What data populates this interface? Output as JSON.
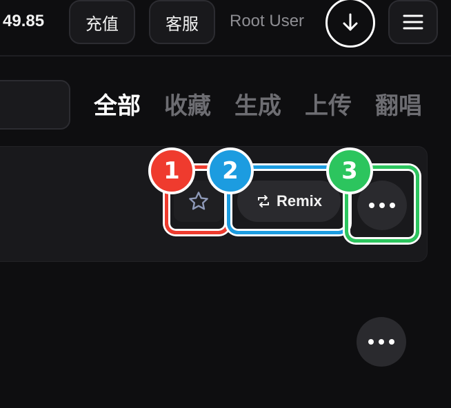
{
  "header": {
    "balance": "49.85",
    "recharge_label": "充值",
    "service_label": "客服",
    "user_name": "Root User",
    "download_icon": "download-icon",
    "menu_icon": "menu-icon"
  },
  "tabs": [
    {
      "label": "全部",
      "active": true
    },
    {
      "label": "收藏",
      "active": false
    },
    {
      "label": "生成",
      "active": false
    },
    {
      "label": "上传",
      "active": false
    },
    {
      "label": "翻唱",
      "active": false
    }
  ],
  "card": {
    "favorite_icon": "star-icon",
    "remix_label": "Remix",
    "remix_icon": "repeat-icon",
    "more_icon": "more-horizontal-icon"
  },
  "annotations": [
    {
      "number": "1",
      "color": "#ef3b2e"
    },
    {
      "number": "2",
      "color": "#1c9ce0"
    },
    {
      "number": "3",
      "color": "#2cc55e"
    }
  ],
  "colors": {
    "background": "#0e0e10",
    "surface": "#19191c",
    "active_tab": "#ffffff",
    "inactive_tab": "#6d6d72"
  }
}
